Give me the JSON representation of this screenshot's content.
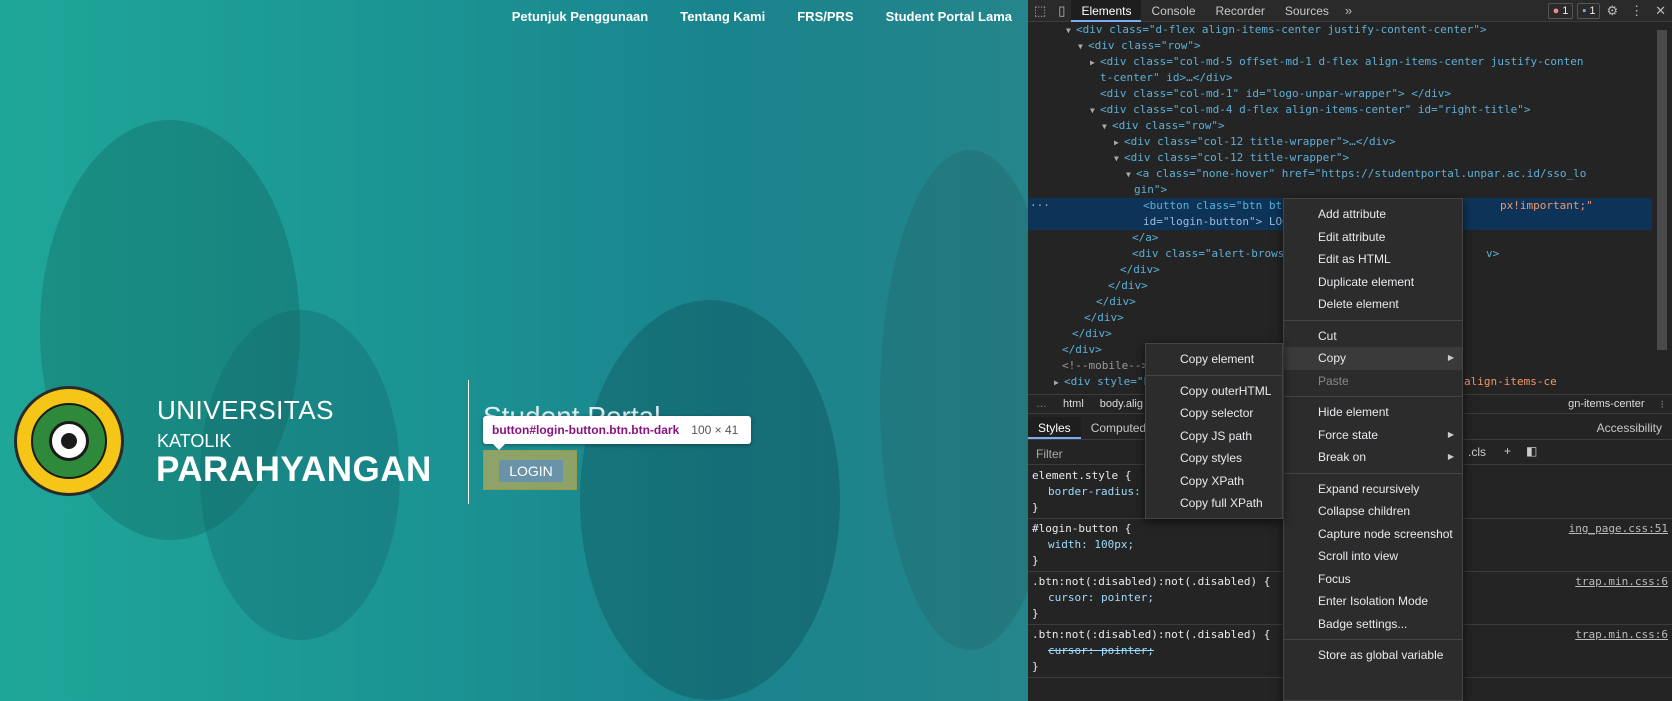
{
  "site": {
    "nav": [
      "Petunjuk Penggunaan",
      "Tentang Kami",
      "FRS/PRS",
      "Student Portal Lama"
    ],
    "uni_line1": "UNIVERSITAS",
    "uni_line2": "KATOLIK",
    "uni_line3": "PARAHYANGAN",
    "portal_title": "Student Portal",
    "tooltip_selector": "button#login-button.btn.btn-dark",
    "tooltip_size": "100 × 41",
    "login_label": "LOGIN",
    "seal_text_top": "UNIVERSITAS KATOLIK",
    "seal_text_bottom": "PARAHYANGAN"
  },
  "devtools": {
    "tabs": [
      "Elements",
      "Console",
      "Recorder",
      "Sources"
    ],
    "more_tabs": "»",
    "error_count": "1",
    "message_count": "1",
    "dom_lines": [
      "<div class=\"d-flex align-items-center justify-content-center\">",
      "<div class=\"row\">",
      "<div class=\"col-md-5 offset-md-1 d-flex align-items-center justify-conten",
      "t-center\" id>…</div>",
      "<div class=\"col-md-1\" id=\"logo-unpar-wrapper\"> </div>",
      "<div class=\"col-md-4  d-flex align-items-center\" id=\"right-title\">",
      "<div class=\"row\">",
      "<div class=\"col-12 title-wrapper\">…</div>",
      "<div class=\"col-12 title-wrapper\">",
      "<a class=\"none-hover\" href=\"https://studentportal.unpar.ac.id/sso_lo",
      "gin\">",
      "<button class=\"btn btn-",
      "px!important;\"",
      "id=\"login-button\"> LOGI",
      "</a>",
      "<div class=\"alert-browse",
      "v>",
      "</div>",
      "</div>",
      "</div>",
      "</div>",
      "</div>",
      "</div>",
      "<!--mobile-->",
      "<div style=\"h",
      "align-items-ce"
    ],
    "crumbs": [
      "html",
      "body.alig",
      "gn-items-center"
    ],
    "style_tabs": [
      "Styles",
      "Computed",
      "Accessibility"
    ],
    "filter_placeholder": "Filter",
    "cls_label": ".cls",
    "rules": [
      {
        "selector": "element.style {",
        "prop": "border-radius:",
        "src": ""
      },
      {
        "selector": "#login-button {",
        "prop": "width: 100px;",
        "src": "ing_page.css:51"
      },
      {
        "selector": ".btn:not(:disabled):not(.disabled) {",
        "prop": "cursor: pointer;",
        "src": "trap.min.css:6"
      },
      {
        "selector": ".btn:not(:disabled):not(.disabled) {",
        "prop": "cursor: pointer;",
        "src": "trap.min.css:6"
      }
    ],
    "close_brace": "}"
  },
  "context_menu": {
    "items": [
      "Add attribute",
      "Edit attribute",
      "Edit as HTML",
      "Duplicate element",
      "Delete element",
      "Cut",
      "Copy",
      "Paste",
      "Hide element",
      "Force state",
      "Break on",
      "Expand recursively",
      "Collapse children",
      "Capture node screenshot",
      "Scroll into view",
      "Focus",
      "Enter Isolation Mode",
      "Badge settings...",
      "Store as global variable"
    ]
  },
  "copy_submenu": {
    "items": [
      "Copy element",
      "Copy outerHTML",
      "Copy selector",
      "Copy JS path",
      "Copy styles",
      "Copy XPath",
      "Copy full XPath"
    ]
  }
}
